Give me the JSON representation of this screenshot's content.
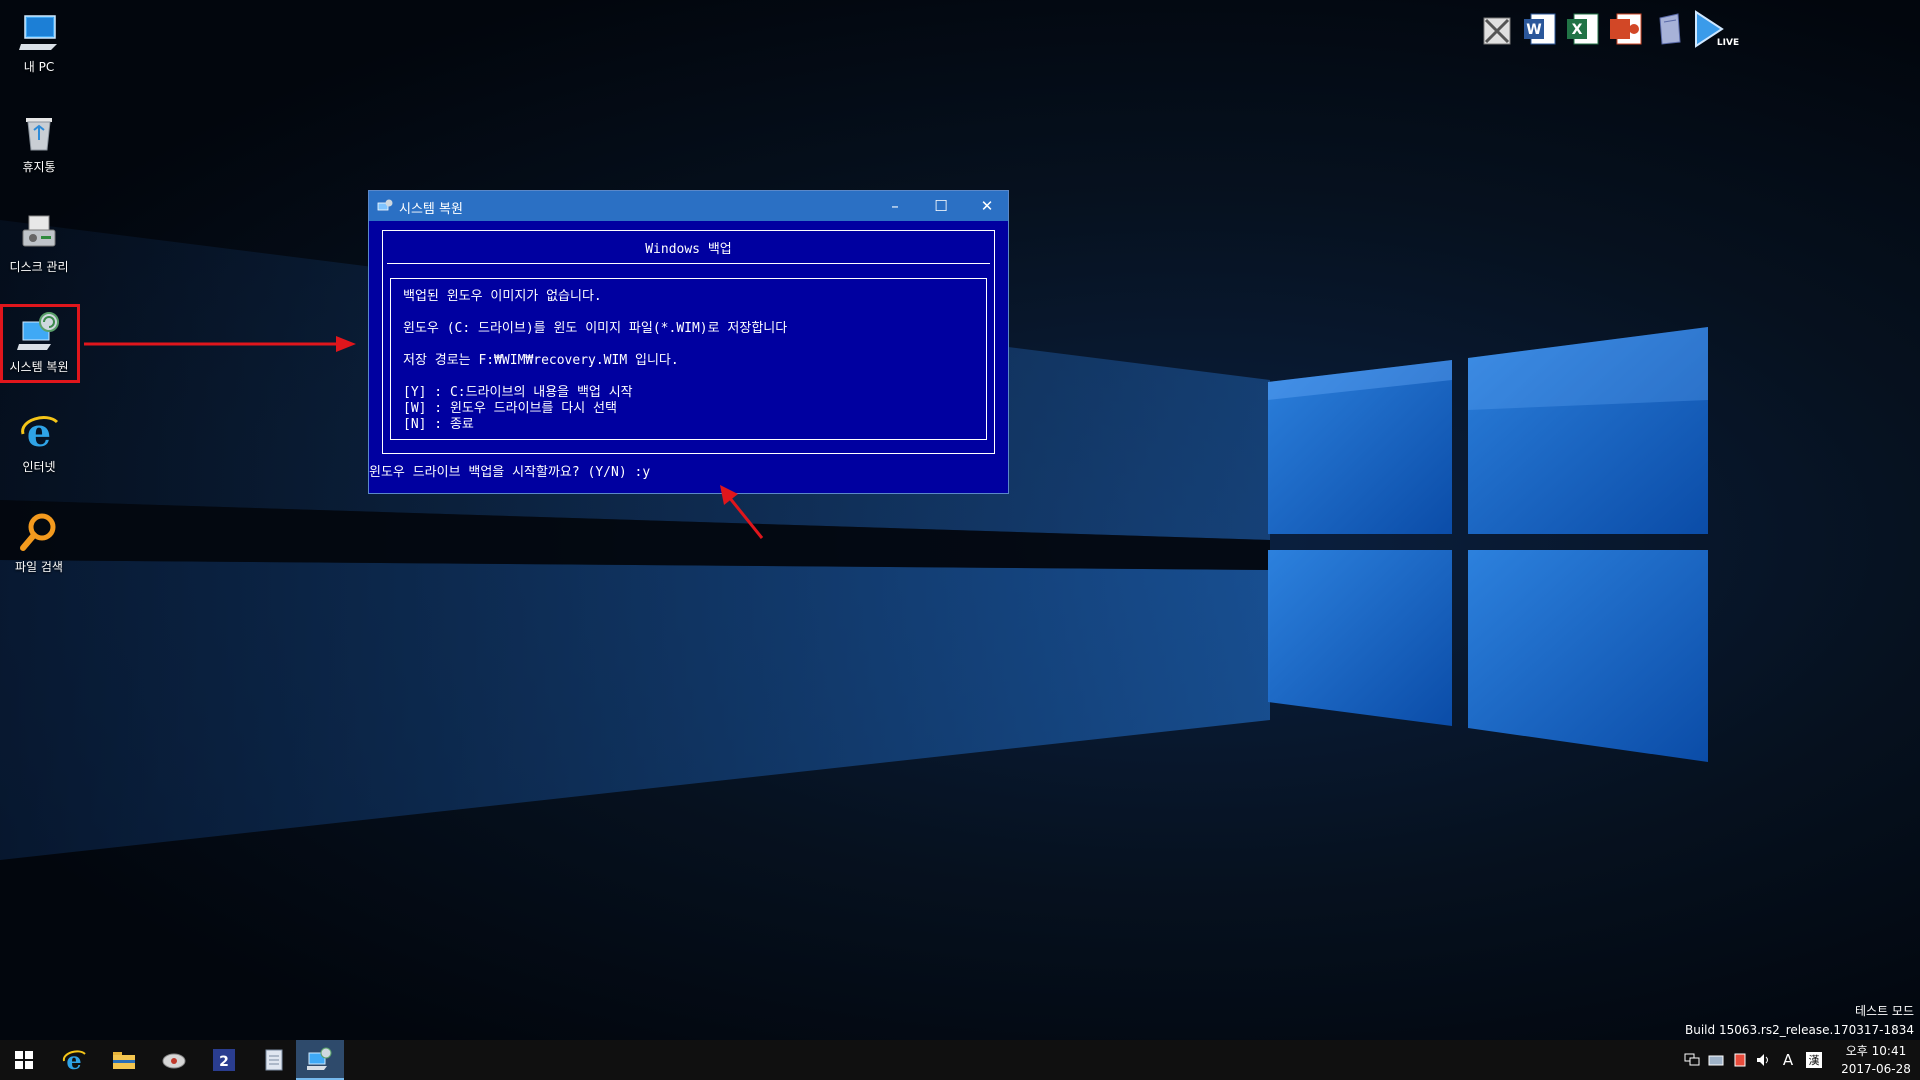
{
  "desktop": {
    "icons": [
      {
        "label": "내 PC"
      },
      {
        "label": "휴지통"
      },
      {
        "label": "디스크 관리"
      },
      {
        "label": "시스템 복원"
      },
      {
        "label": "인터넷"
      },
      {
        "label": "파일 검색"
      }
    ]
  },
  "quickbar": {
    "items": [
      "tools-icon",
      "word-icon",
      "excel-icon",
      "powerpoint-icon",
      "notebook-icon",
      "live-play-icon"
    ],
    "live_label": "LIVE"
  },
  "window": {
    "title": "시스템 복원",
    "minimize": "–",
    "maximize": "☐",
    "close": "✕",
    "header": "Windows 백업",
    "lines": [
      "백업된 윈도우 이미지가 없습니다.",
      "윈도우 (C: 드라이브)를 윈도 이미지 파일(*.WIM)로 저장합니다",
      "저장 경로는 F:₩WIM₩recovery.WIM 입니다.",
      "[Y] : C:드라이브의 내용을 백업 시작",
      "[W] : 윈도우 드라이브를 다시 선택",
      "[N] : 종료"
    ],
    "prompt": "윈도우 드라이브 백업을 시작할까요? (Y/N) :y"
  },
  "watermark": {
    "mode": "테스트 모드",
    "build": "Build 15063.rs2_release.170317-1834"
  },
  "taskbar": {
    "items": [
      "start-button",
      "internet-explorer",
      "file-explorer",
      "disk-tool",
      "app-2",
      "notepad",
      "system-restore"
    ],
    "app2_label": "2",
    "tray": {
      "ime": "A",
      "lang": "漢"
    },
    "clock": {
      "time": "오후 10:41",
      "date": "2017-06-28"
    }
  },
  "colors": {
    "console_bg": "#0000a0",
    "titlebar": "#2b70c4",
    "annotation_red": "#e0161c"
  }
}
